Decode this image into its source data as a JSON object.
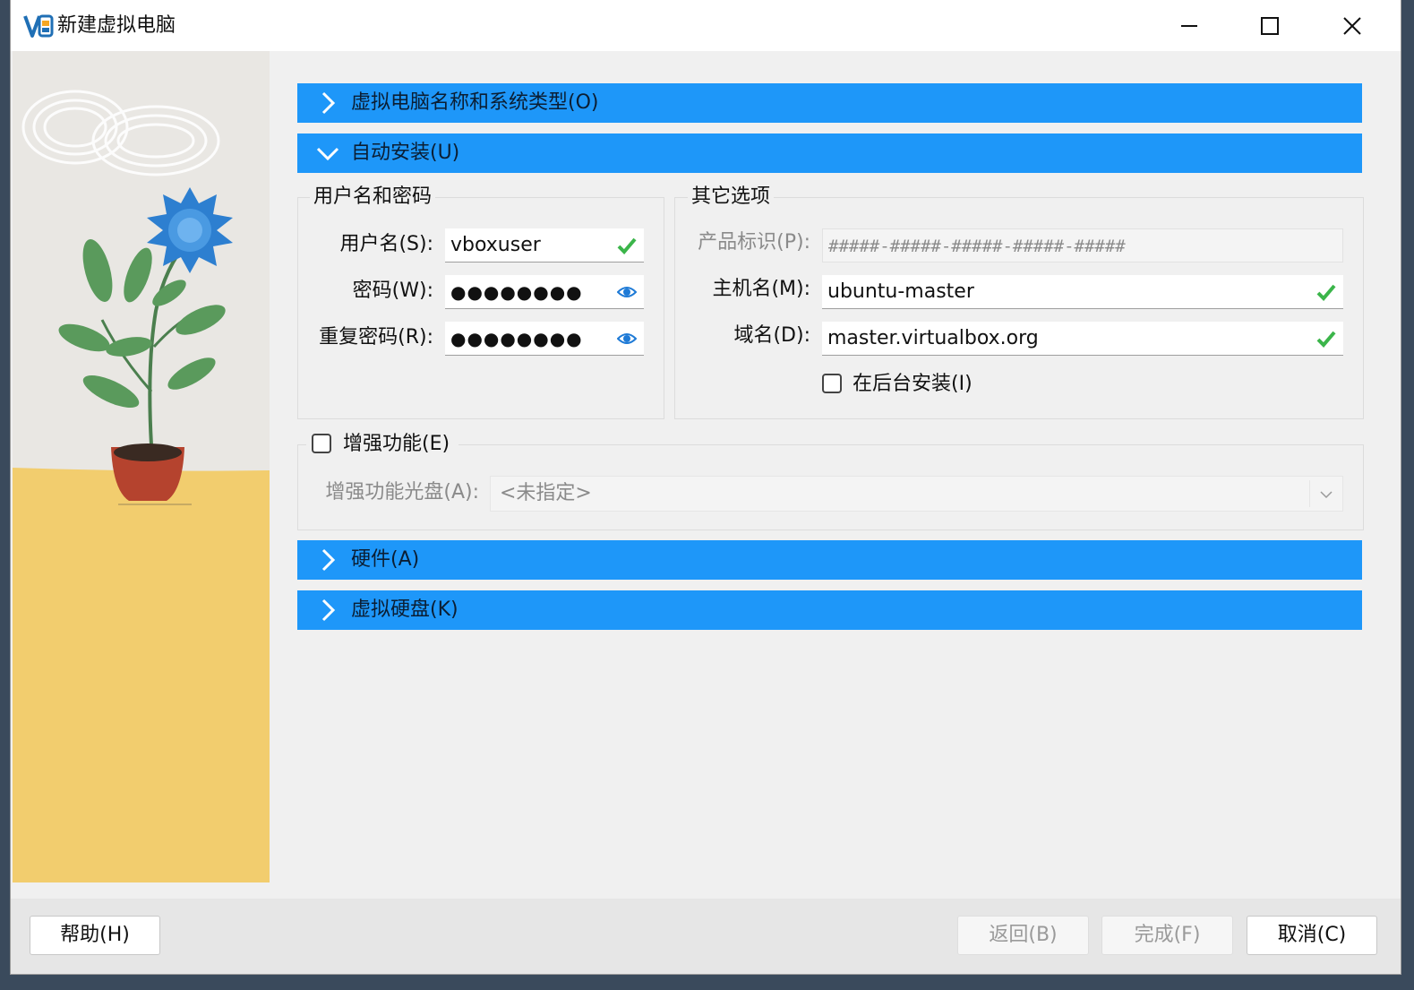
{
  "window": {
    "title": "新建虚拟电脑"
  },
  "sections": {
    "name_type": "虚拟电脑名称和系统类型(O)",
    "unattended": "自动安装(U)",
    "hardware": "硬件(A)",
    "disk": "虚拟硬盘(K)"
  },
  "user_group": {
    "title": "用户名和密码",
    "username_label": "用户名(S):",
    "username_value": "vboxuser",
    "password_label": "密码(W):",
    "password_value": "●●●●●●●●",
    "repeat_label": "重复密码(R):",
    "repeat_value": "●●●●●●●●"
  },
  "other_group": {
    "title": "其它选项",
    "product_key_label": "产品标识(P):",
    "product_key_placeholder": "#####-#####-#####-#####-#####",
    "hostname_label": "主机名(M):",
    "hostname_value": "ubuntu-master",
    "domain_label": "域名(D):",
    "domain_value": "master.virtualbox.org",
    "background_install_label": "在后台安装(I)"
  },
  "guest_additions": {
    "checkbox_label": "增强功能(E)",
    "iso_label": "增强功能光盘(A):",
    "iso_value": "<未指定>"
  },
  "footer": {
    "help": "帮助(H)",
    "back": "返回(B)",
    "finish": "完成(F)",
    "cancel": "取消(C)"
  },
  "colors": {
    "section_bar": "#1e97f9",
    "check_green": "#3bb54a",
    "eye_blue": "#1e7ad6"
  }
}
